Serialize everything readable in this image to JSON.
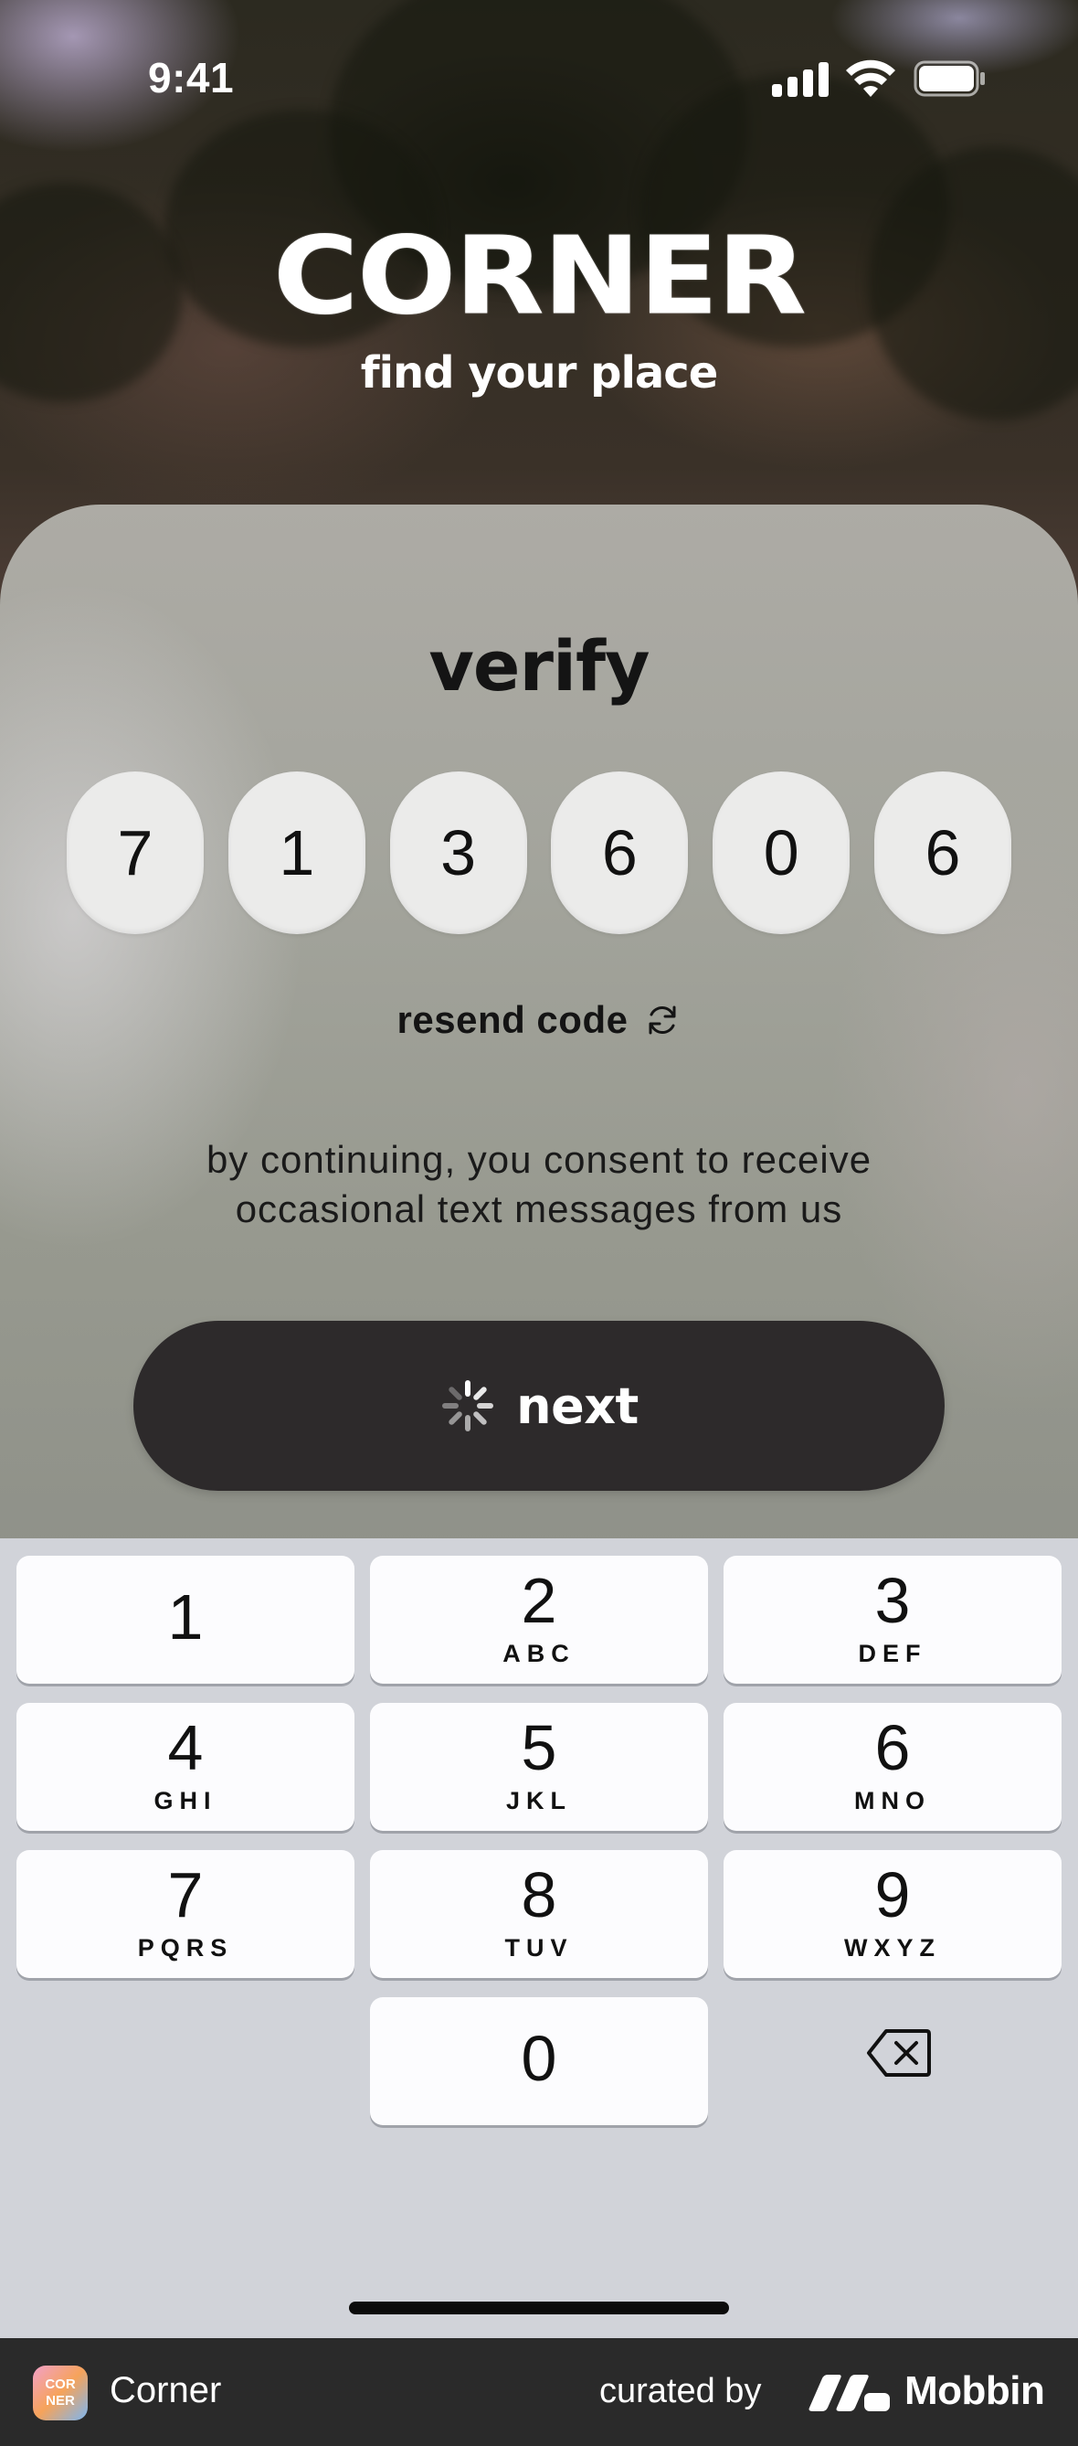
{
  "status_bar": {
    "time": "9:41"
  },
  "brand": {
    "logo": "CORNER",
    "tagline": "find your place"
  },
  "verify": {
    "title": "verify",
    "code_digits": [
      "7",
      "1",
      "3",
      "6",
      "0",
      "6"
    ],
    "resend_label": "resend code",
    "resend_icon": "refresh-icon",
    "consent_line1": "by continuing, you consent to receive",
    "consent_line2": "occasional text messages from us",
    "next_label": "next",
    "next_state": "loading"
  },
  "keypad": {
    "keys": [
      {
        "num": "1",
        "letters": ""
      },
      {
        "num": "2",
        "letters": "ABC"
      },
      {
        "num": "3",
        "letters": "DEF"
      },
      {
        "num": "4",
        "letters": "GHI"
      },
      {
        "num": "5",
        "letters": "JKL"
      },
      {
        "num": "6",
        "letters": "MNO"
      },
      {
        "num": "7",
        "letters": "PQRS"
      },
      {
        "num": "8",
        "letters": "TUV"
      },
      {
        "num": "9",
        "letters": "WXYZ"
      },
      {
        "num": "0",
        "letters": ""
      }
    ],
    "delete_icon": "backspace-icon"
  },
  "footer": {
    "app_icon_text": "COR NER",
    "app_name": "Corner",
    "curated_by": "curated by",
    "mobbin": "Mobbin"
  },
  "colors": {
    "button_dark": "#2d2a2b",
    "code_box": "#ebebea",
    "keypad_bg": "#d1d3d9",
    "footer_bg": "#2a2a2a"
  }
}
